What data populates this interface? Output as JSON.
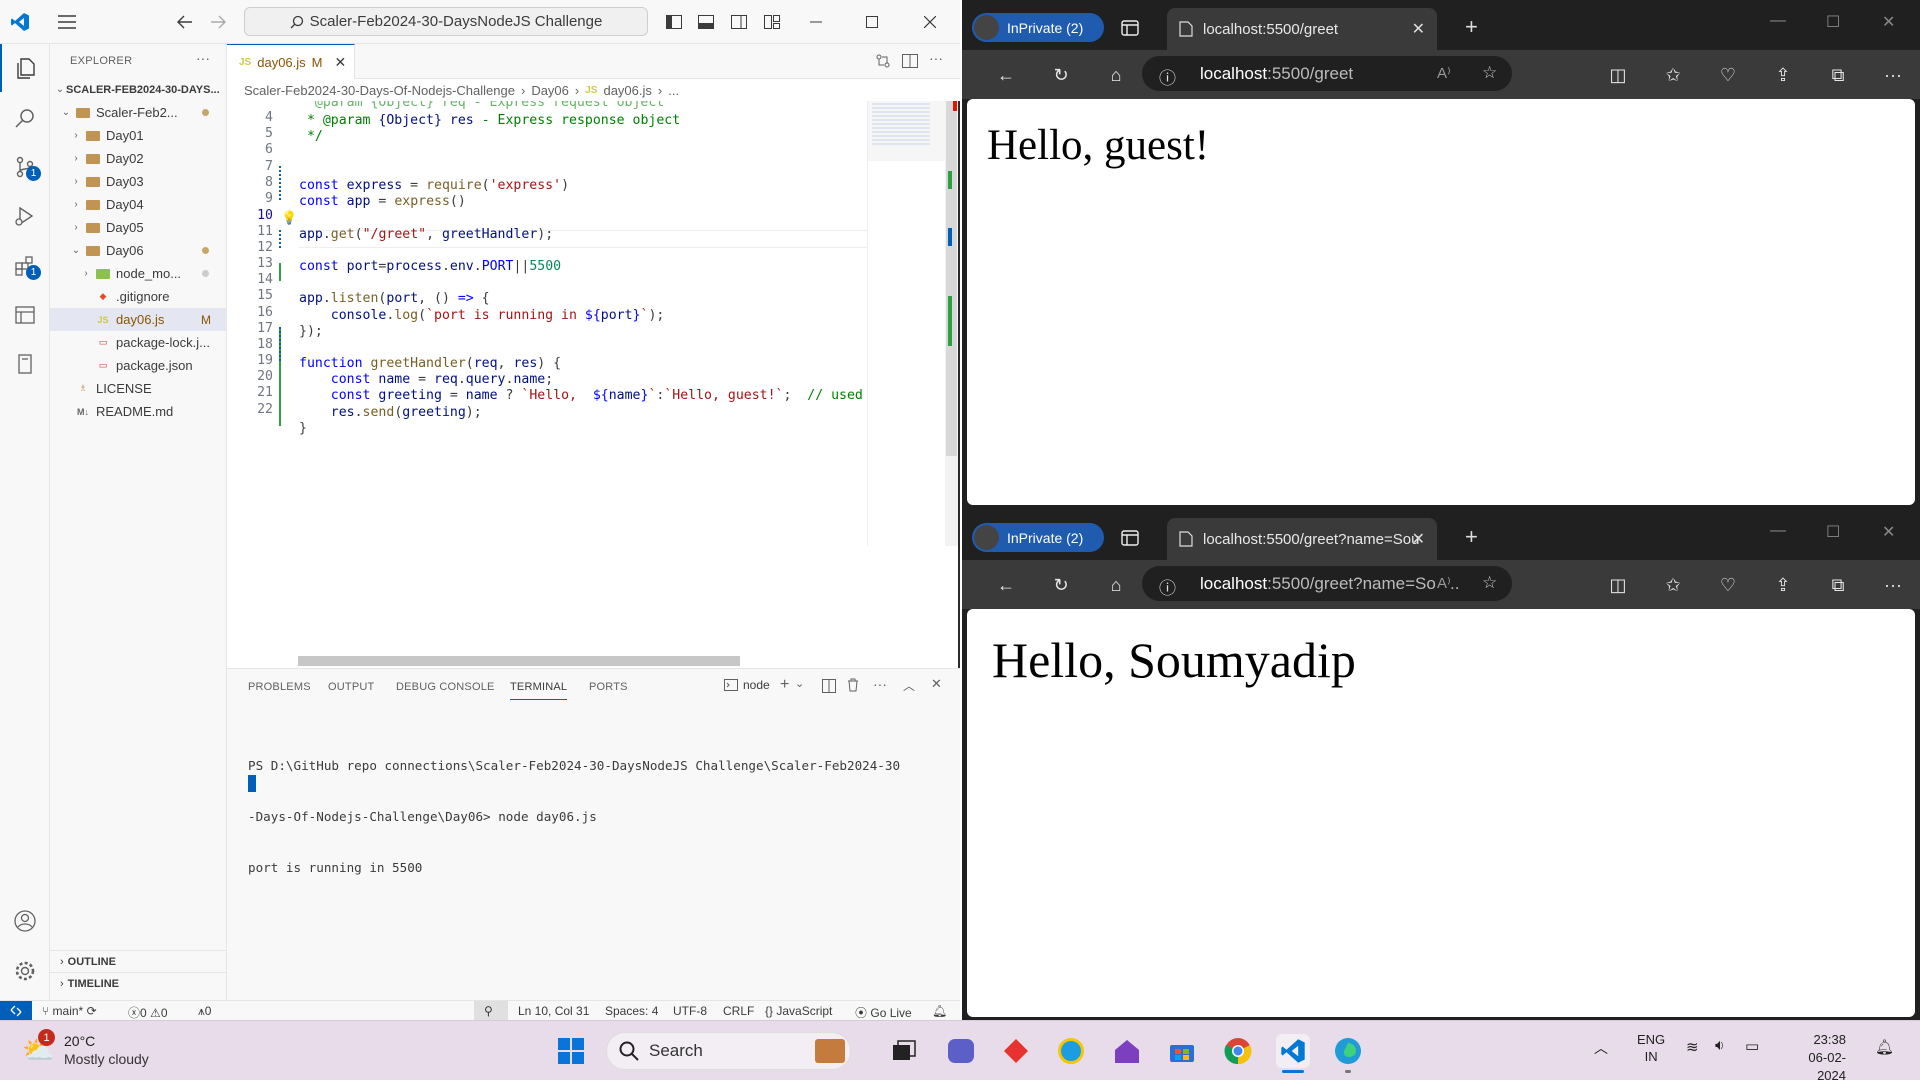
{
  "vscode": {
    "command_center": "Scaler-Feb2024-30-DaysNodeJS Challenge",
    "explorer_title": "EXPLORER",
    "root_folder": "SCALER-FEB2024-30-DAYS...",
    "tree": [
      {
        "label": "Scaler-Feb2...",
        "type": "folder",
        "open": true,
        "color": "#c7a66b"
      },
      {
        "label": "Day01",
        "type": "folder"
      },
      {
        "label": "Day02",
        "type": "folder"
      },
      {
        "label": "Day03",
        "type": "folder"
      },
      {
        "label": "Day04",
        "type": "folder"
      },
      {
        "label": "Day05",
        "type": "folder"
      },
      {
        "label": "Day06",
        "type": "folder",
        "open": true,
        "color": "#c7a66b"
      },
      {
        "label": "node_mo...",
        "type": "folder"
      },
      {
        "label": ".gitignore",
        "type": "file"
      },
      {
        "label": "day06.js",
        "type": "file",
        "status": "M"
      },
      {
        "label": "package-lock.j...",
        "type": "file"
      },
      {
        "label": "package.json",
        "type": "file"
      },
      {
        "label": "LICENSE",
        "type": "file"
      },
      {
        "label": "README.md",
        "type": "file"
      }
    ],
    "outline_label": "OUTLINE",
    "timeline_label": "TIMELINE",
    "tab": {
      "icon": "JS",
      "name": "day06.js",
      "status": "M"
    },
    "breadcrumb": [
      "Scaler-Feb2024-30-Days-Of-Nodejs-Challenge",
      "Day06",
      "day06.js",
      "..."
    ],
    "line_numbers": [
      "4",
      "5",
      "6",
      "7",
      "8",
      "9",
      "10",
      "11",
      "12",
      "13",
      "14",
      "15",
      "16",
      "17",
      "18",
      "19",
      "20",
      "21",
      "22"
    ],
    "current_line": "10",
    "panel_tabs": [
      "PROBLEMS",
      "OUTPUT",
      "DEBUG CONSOLE",
      "TERMINAL",
      "PORTS"
    ],
    "active_panel_tab": "TERMINAL",
    "terminal_shell": "node",
    "terminal_lines": [
      "PS D:\\GitHub repo connections\\Scaler-Feb2024-30-DaysNodeJS Challenge\\Scaler-Feb2024-30",
      "-Days-Of-Nodejs-Challenge\\Day06> node day06.js",
      "port is running in 5500"
    ],
    "status": {
      "branch": "main*",
      "errors": "0",
      "warnings": "0",
      "ports": "0",
      "position": "Ln 10, Col 31",
      "spaces": "Spaces: 4",
      "encoding": "UTF-8",
      "eol": "CRLF",
      "language": "JavaScript",
      "golive": "Go Live"
    }
  },
  "browser_top": {
    "profile": "InPrivate (2)",
    "tab_title": "localhost:5500/greet",
    "url_host": "localhost",
    "url_rest": ":5500/greet",
    "heading": "Hello, guest!"
  },
  "browser_bottom": {
    "profile": "InPrivate (2)",
    "tab_title": "localhost:5500/greet?name=Sou",
    "url_host": "localhost",
    "url_rest": ":5500/greet?name=Sou...",
    "heading": "Hello, Soumyadip"
  },
  "taskbar": {
    "weather_temp": "20°C",
    "weather_desc": "Mostly cloudy",
    "weather_badge": "1",
    "search_label": "Search",
    "lang_line1": "ENG",
    "lang_line2": "IN",
    "time": "23:38",
    "date": "06-02-2024"
  }
}
